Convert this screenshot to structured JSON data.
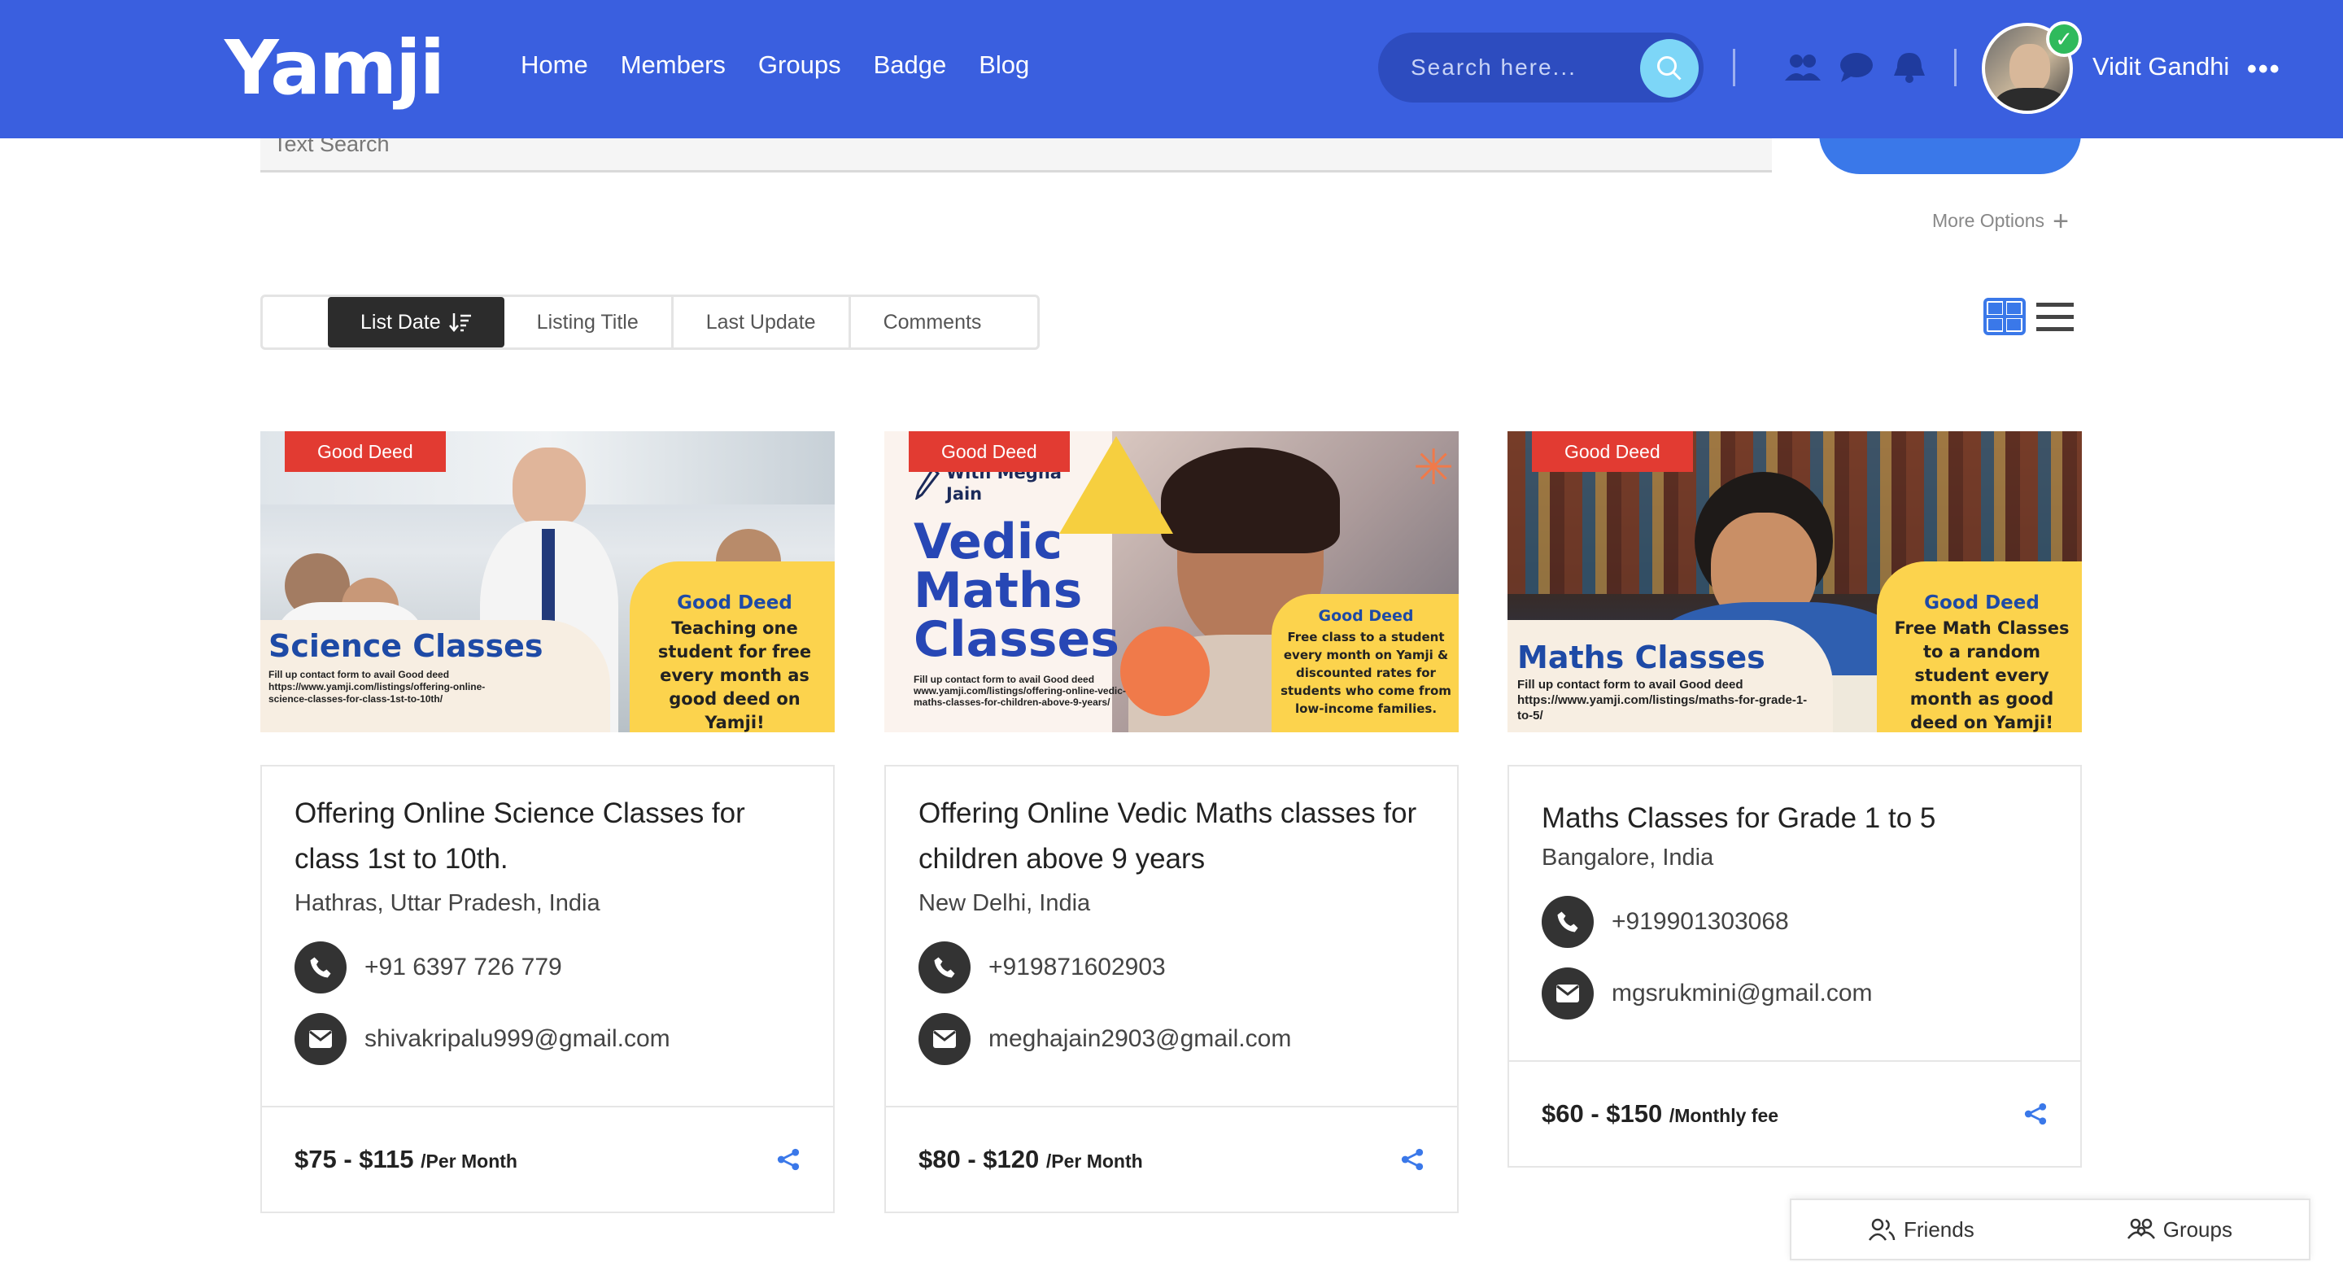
{
  "header": {
    "logo": "Yamji",
    "nav": [
      "Home",
      "Members",
      "Groups",
      "Badge",
      "Blog"
    ],
    "search_placeholder": "Search here...",
    "username": "Vidit Gandhi",
    "accent": "#3a5fdf"
  },
  "filters": {
    "text_search_placeholder": "Text Search",
    "more_options": "More Options"
  },
  "sort": {
    "options": [
      "List Date",
      "Listing Title",
      "Last Update",
      "Comments"
    ],
    "active": "List Date"
  },
  "listings": [
    {
      "badge": "Good Deed",
      "image_headline": "Science Classes",
      "image_sub": "Fill up contact form to avail Good deed https://www.yamji.com/listings/offering-online-science-classes-for-class-1st-to-10th/",
      "image_panel_title": "Good Deed",
      "image_panel_text": "Teaching one student for free every month as good deed on Yamji!",
      "title": "Offering Online Science Classes for class 1st to 10th.",
      "location": "Hathras, Uttar Pradesh, India",
      "phone": "+91 6397 726 779",
      "email": "shivakripalu999@gmail.com",
      "price": "$75 - $115",
      "unit": "/Per Month"
    },
    {
      "badge": "Good Deed",
      "image_headline": "Vedic Maths Classes",
      "image_with": "With Megha Jain",
      "image_sub": "Fill up contact form to avail Good deed www.yamji.com/listings/offering-online-vedic-maths-classes-for-children-above-9-years/",
      "image_panel_title": "Good Deed",
      "image_panel_text": "Free class to a student every month on Yamji & discounted rates for students who come from low-income families.",
      "title": "Offering Online Vedic Maths classes for children above 9 years",
      "location": "New Delhi, India",
      "phone": "+919871602903",
      "email": "meghajain2903@gmail.com",
      "price": "$80 - $120",
      "unit": "/Per Month"
    },
    {
      "badge": "Good Deed",
      "image_headline": "Maths Classes",
      "image_sub": "Fill up contact form to avail Good deed https://www.yamji.com/listings/maths-for-grade-1-to-5/",
      "image_panel_title": "Good Deed",
      "image_panel_text": "Free Math Classes to a random student every month as good deed on Yamji!",
      "title": "Maths Classes for Grade 1 to 5",
      "location": "Bangalore, India",
      "phone": "+919901303068",
      "email": "mgsrukmini@gmail.com",
      "price": "$60 - $150",
      "unit": "/Monthly fee"
    }
  ],
  "chatbar": {
    "friends": "Friends",
    "groups": "Groups"
  }
}
